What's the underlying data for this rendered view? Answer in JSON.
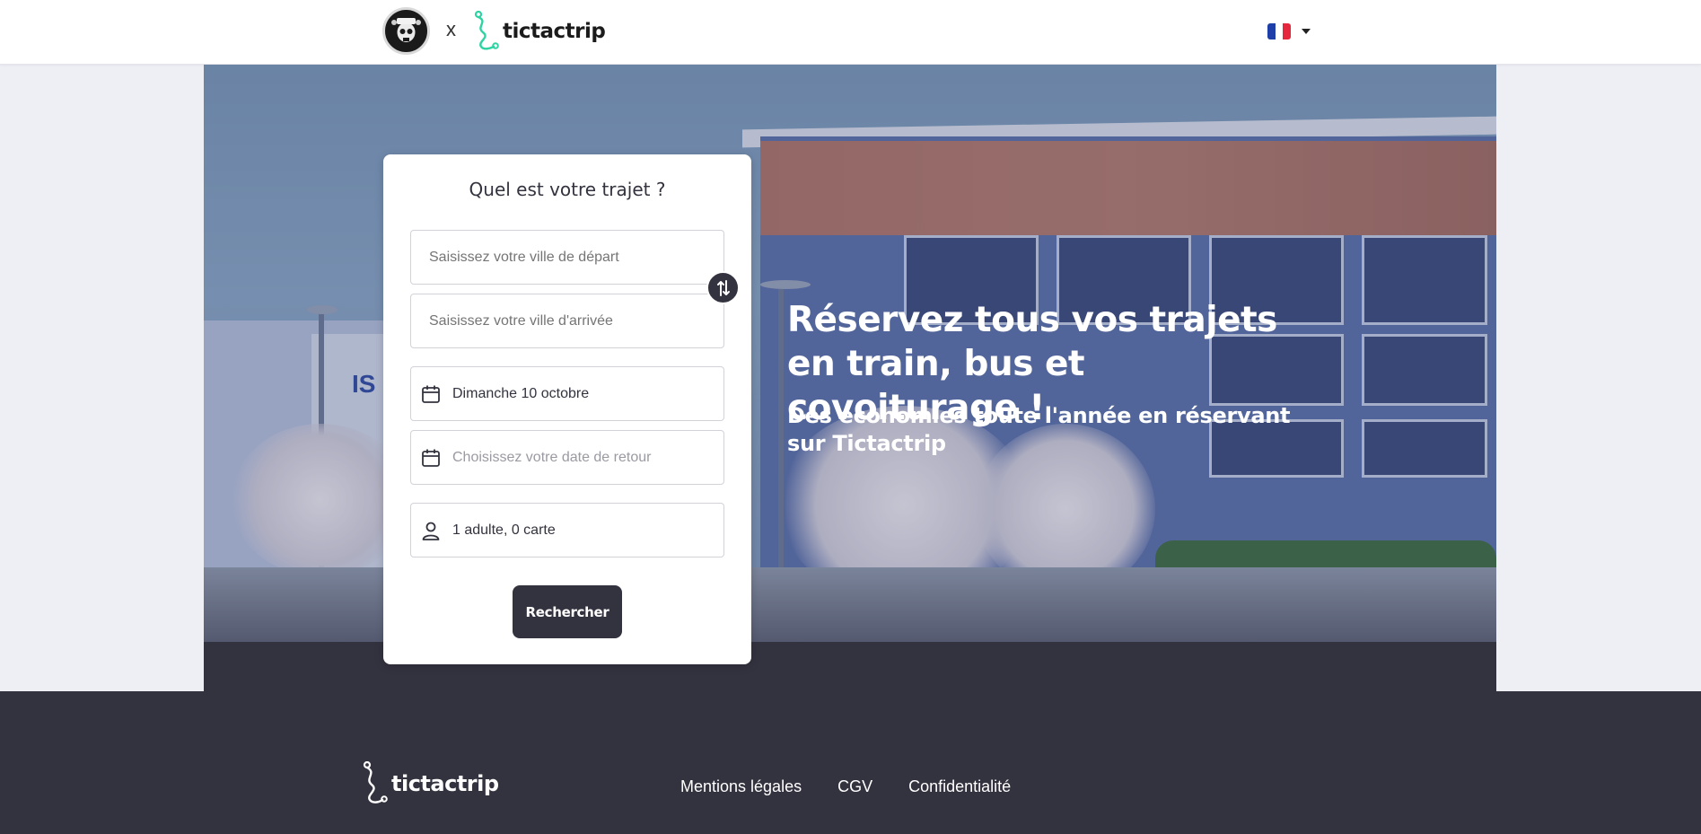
{
  "header": {
    "partner_logo_icon": "pirate-skull-logo",
    "separator": "x",
    "brand_name": "tictactrip",
    "language": {
      "flag_icon": "france-flag-icon",
      "flag_colors": [
        "#1e3ea8",
        "#ffffff",
        "#e5283d"
      ]
    }
  },
  "hero": {
    "headline": "Réservez tous vos trajets en train, bus et covoiturage !",
    "subheadline": "Des économies toute l'année en réservant sur Tictactrip"
  },
  "search": {
    "title": "Quel est votre trajet ?",
    "departure_placeholder": "Saisissez votre ville de départ",
    "arrival_placeholder": "Saisissez votre ville d'arrivée",
    "departure_date": "Dimanche 10 octobre",
    "return_date_placeholder": "Choisissez votre date de retour",
    "passengers": "1 adulte, 0 carte",
    "search_label": "Rechercher"
  },
  "footer": {
    "brand_name": "tictactrip",
    "links": [
      "Mentions légales",
      "CGV",
      "Confidentialité"
    ]
  },
  "colors": {
    "accent_dark": "#33323f",
    "brand_green": "#2fd3a3",
    "page_bg": "#eeeef5"
  }
}
